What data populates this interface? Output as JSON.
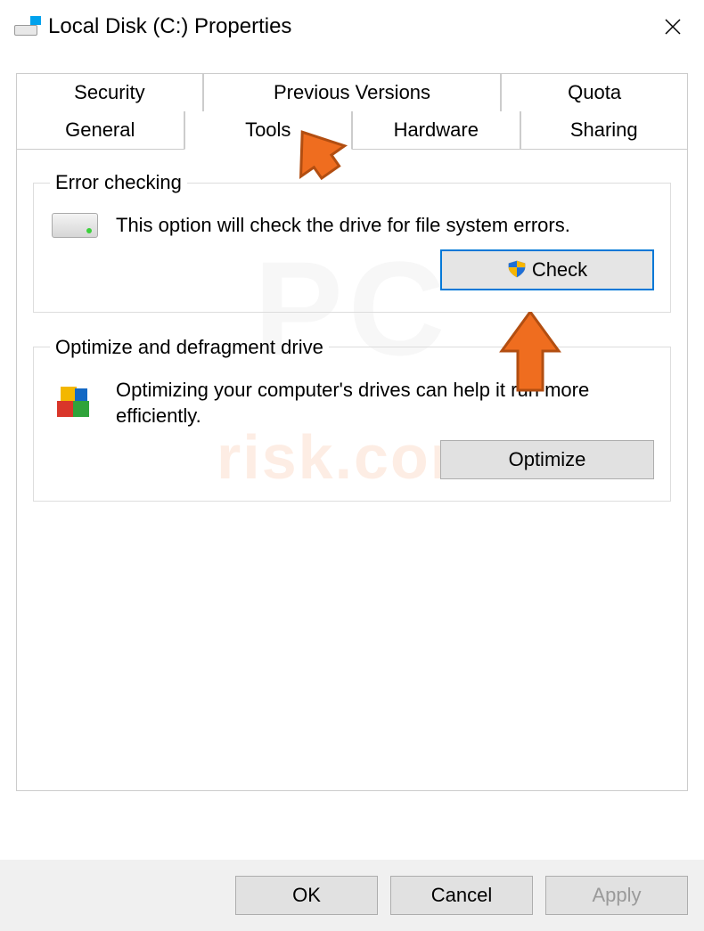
{
  "window": {
    "title": "Local Disk (C:) Properties"
  },
  "tabs": {
    "row1": [
      "Security",
      "Previous Versions",
      "Quota"
    ],
    "row2": [
      "General",
      "Tools",
      "Hardware",
      "Sharing"
    ],
    "active": "Tools"
  },
  "errorChecking": {
    "legend": "Error checking",
    "text": "This option will check the drive for file system errors.",
    "button": "Check"
  },
  "optimize": {
    "legend": "Optimize and defragment drive",
    "text": "Optimizing your computer's drives can help it run more efficiently.",
    "button": "Optimize"
  },
  "footer": {
    "ok": "OK",
    "cancel": "Cancel",
    "apply": "Apply"
  },
  "watermark": {
    "big": "PC",
    "small": "risk.com"
  }
}
